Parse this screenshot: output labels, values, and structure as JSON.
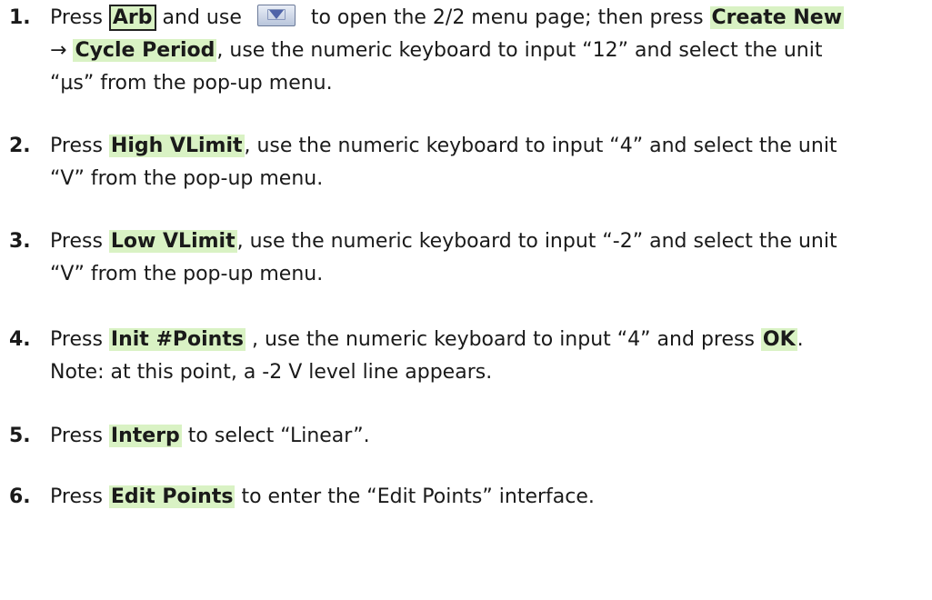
{
  "steps": [
    {
      "number": "1.",
      "parts": [
        "Press ",
        "Arb",
        " and use ",
        " to open the 2/2 menu page; then press ",
        "Create New",
        "→ ",
        "Cycle Period",
        ", use the numeric keyboard to input “12” and select the unit",
        "“µs” from the pop-up menu."
      ],
      "icon": "down-arrow-page-icon"
    },
    {
      "number": "2.",
      "parts": [
        "Press ",
        "High VLimit",
        ", use the numeric keyboard to input “4” and select the unit",
        "“V” from the pop-up menu."
      ]
    },
    {
      "number": "3.",
      "parts": [
        "Press ",
        "Low VLimit",
        ", use the numeric keyboard to input “-2” and select the unit",
        "“V” from the pop-up menu."
      ]
    },
    {
      "number": "4.",
      "parts": [
        "Press ",
        "Init #Points",
        " , use the numeric keyboard to input “4” and press ",
        "OK",
        ".",
        "Note: at this point, a -2 V level line appears."
      ]
    },
    {
      "number": "5.",
      "parts": [
        "Press ",
        "Interp",
        " to select “Linear”."
      ]
    },
    {
      "number": "6.",
      "parts": [
        "Press ",
        "Edit Points",
        " to enter the “Edit Points” interface."
      ]
    }
  ],
  "colors": {
    "key_highlight": "#d9f2c4",
    "text": "#1a1a1a"
  }
}
